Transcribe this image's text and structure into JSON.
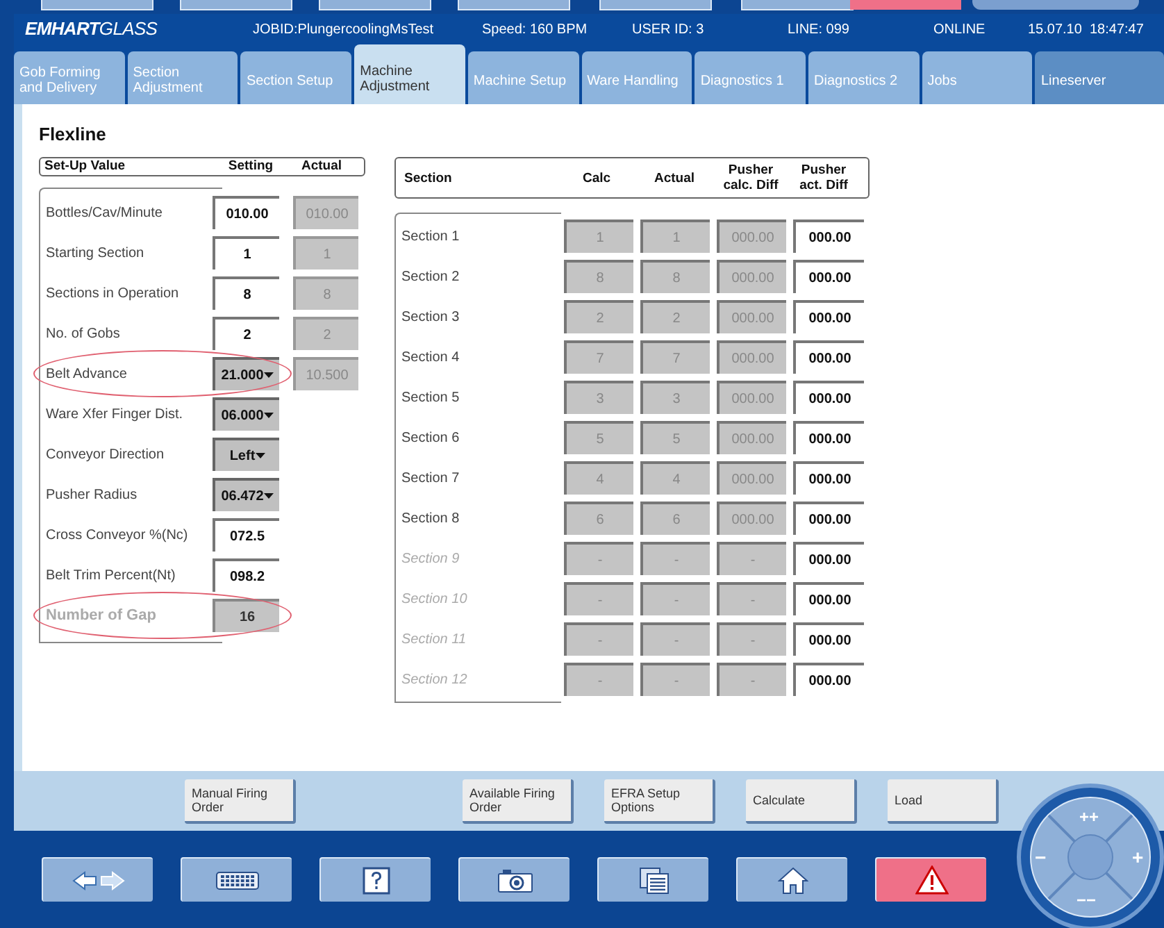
{
  "header": {
    "logo": "**EMHART**GLASS",
    "job": "JOBID:PlungercoolingMsTest",
    "speed": "Speed: 160 BPM",
    "user": "USER ID: 3",
    "line": "LINE: 099",
    "status": "ONLINE",
    "datetime": "15.07.10  18:47:47"
  },
  "tabs": [
    {
      "label": "Gob Forming and Delivery",
      "selected": false
    },
    {
      "label": "Section Adjustment",
      "selected": false
    },
    {
      "label": "Section Setup",
      "selected": false
    },
    {
      "label": "Machine Adjustment",
      "selected": true
    },
    {
      "label": "Machine Setup",
      "selected": false
    },
    {
      "label": "Ware Handling",
      "selected": false
    },
    {
      "label": "Diagnostics 1",
      "selected": false
    },
    {
      "label": "Diagnostics 2",
      "selected": false
    },
    {
      "label": "Jobs",
      "selected": false
    },
    {
      "label": "Lineserver",
      "selected": false
    }
  ],
  "title": "Flexline",
  "setup": {
    "columns": [
      "Set-Up Value",
      "Setting",
      "Actual"
    ],
    "rows": [
      {
        "kind": "input",
        "label": "Bottles/Cav/Minute",
        "setting": "010.00",
        "actual": "010.00",
        "highlighted": false,
        "disabled": false
      },
      {
        "kind": "input",
        "label": "Starting Section",
        "setting": "1",
        "actual": "1",
        "highlighted": false,
        "disabled": false
      },
      {
        "kind": "input",
        "label": "Sections in Operation",
        "setting": "8",
        "actual": "8",
        "highlighted": false,
        "disabled": false
      },
      {
        "kind": "input",
        "label": "No. of Gobs",
        "setting": "2",
        "actual": "2",
        "highlighted": false,
        "disabled": false
      },
      {
        "kind": "dropdown",
        "label": "Belt Advance",
        "setting": "21.000",
        "actual": "10.500",
        "highlighted": true,
        "disabled": false
      },
      {
        "kind": "dropdown",
        "label": "Ware Xfer Finger Dist.",
        "setting": "06.000",
        "highlighted": false,
        "disabled": false
      },
      {
        "kind": "dropdown",
        "label": "Conveyor Direction",
        "setting": "Left",
        "highlighted": false,
        "disabled": false
      },
      {
        "kind": "dropdown",
        "label": "Pusher Radius",
        "setting": "06.472",
        "highlighted": false,
        "disabled": false
      },
      {
        "kind": "input",
        "label": "Cross Conveyor %(Nc)",
        "setting": "072.5",
        "highlighted": false,
        "disabled": false
      },
      {
        "kind": "input",
        "label": "Belt Trim Percent(Nt)",
        "setting": "098.2",
        "highlighted": false,
        "disabled": false
      },
      {
        "kind": "display",
        "label": "Number of Gap",
        "setting": "16",
        "highlighted": true,
        "disabled": true
      }
    ]
  },
  "sections": {
    "columns": [
      "Section",
      "Calc",
      "Actual",
      "Pusher calc. Diff",
      "Pusher act. Diff"
    ],
    "rows": [
      {
        "name": "Section 1",
        "calc": "1",
        "actual": "1",
        "calc_diff": "000.00",
        "act_diff": "000.00",
        "disabled": false
      },
      {
        "name": "Section 2",
        "calc": "8",
        "actual": "8",
        "calc_diff": "000.00",
        "act_diff": "000.00",
        "disabled": false
      },
      {
        "name": "Section 3",
        "calc": "2",
        "actual": "2",
        "calc_diff": "000.00",
        "act_diff": "000.00",
        "disabled": false
      },
      {
        "name": "Section 4",
        "calc": "7",
        "actual": "7",
        "calc_diff": "000.00",
        "act_diff": "000.00",
        "disabled": false
      },
      {
        "name": "Section 5",
        "calc": "3",
        "actual": "3",
        "calc_diff": "000.00",
        "act_diff": "000.00",
        "disabled": false
      },
      {
        "name": "Section 6",
        "calc": "5",
        "actual": "5",
        "calc_diff": "000.00",
        "act_diff": "000.00",
        "disabled": false
      },
      {
        "name": "Section 7",
        "calc": "4",
        "actual": "4",
        "calc_diff": "000.00",
        "act_diff": "000.00",
        "disabled": false
      },
      {
        "name": "Section 8",
        "calc": "6",
        "actual": "6",
        "calc_diff": "000.00",
        "act_diff": "000.00",
        "disabled": false
      },
      {
        "name": "Section 9",
        "calc": "-",
        "actual": "-",
        "calc_diff": "-",
        "act_diff": "000.00",
        "disabled": true
      },
      {
        "name": "Section 10",
        "calc": "-",
        "actual": "-",
        "calc_diff": "-",
        "act_diff": "000.00",
        "disabled": true
      },
      {
        "name": "Section 11",
        "calc": "-",
        "actual": "-",
        "calc_diff": "-",
        "act_diff": "000.00",
        "disabled": true
      },
      {
        "name": "Section 12",
        "calc": "-",
        "actual": "-",
        "calc_diff": "-",
        "act_diff": "000.00",
        "disabled": true
      }
    ]
  },
  "actions": [
    {
      "label": "Manual Firing Order"
    },
    {
      "label": "Available Firing Order"
    },
    {
      "label": "EFRA Setup Options"
    },
    {
      "label": "Calculate"
    },
    {
      "label": "Load"
    }
  ],
  "toolbar": [
    {
      "kind": "arrows"
    },
    {
      "kind": "keyboard"
    },
    {
      "kind": "help"
    },
    {
      "kind": "camera"
    },
    {
      "kind": "pages"
    },
    {
      "kind": "home"
    },
    {
      "kind": "alarm"
    }
  ],
  "joystick": {
    "up": "++",
    "right": "+",
    "left": "−",
    "down": "−−"
  }
}
